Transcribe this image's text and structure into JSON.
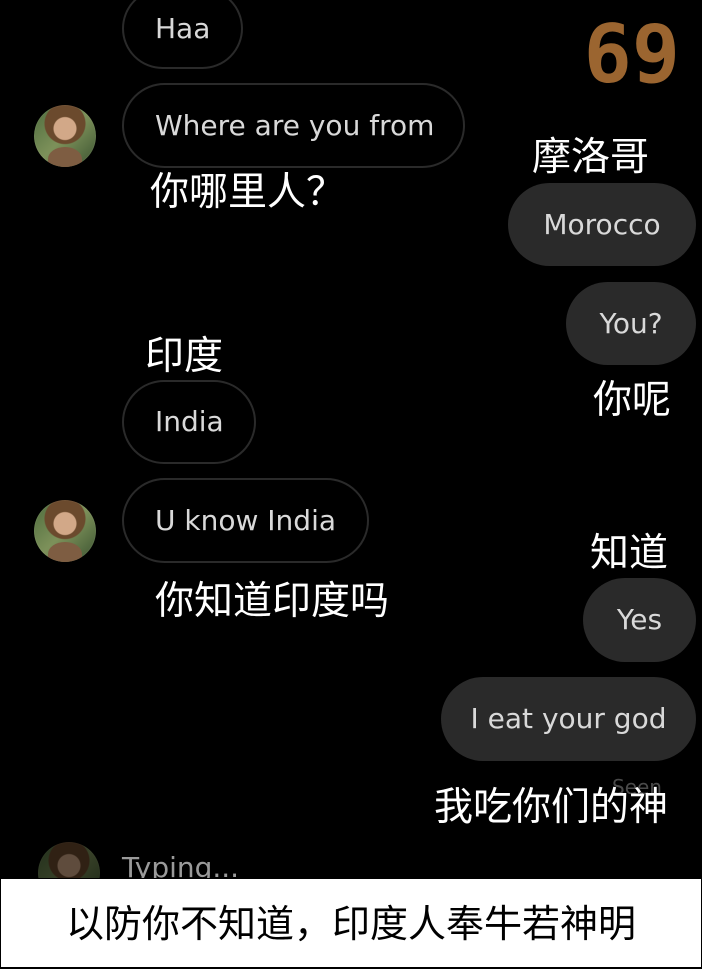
{
  "messages": {
    "haa": "Haa",
    "where": "Where are you from",
    "morocco": "Morocco",
    "you": "You?",
    "india": "India",
    "u_know_india": "U know India",
    "yes": "Yes",
    "eat_god": "I eat your god"
  },
  "annotations": {
    "where": "你哪里人？",
    "morocco": "摩洛哥",
    "you": "你呢",
    "india": "印度",
    "u_know_india": "你知道印度吗",
    "yes": "知道",
    "eat_god": "我吃你们的神"
  },
  "status": {
    "seen": "Seen",
    "typing": "Typing..."
  },
  "number_badge": "69",
  "caption": "以防你不知道，印度人奉牛若神明"
}
